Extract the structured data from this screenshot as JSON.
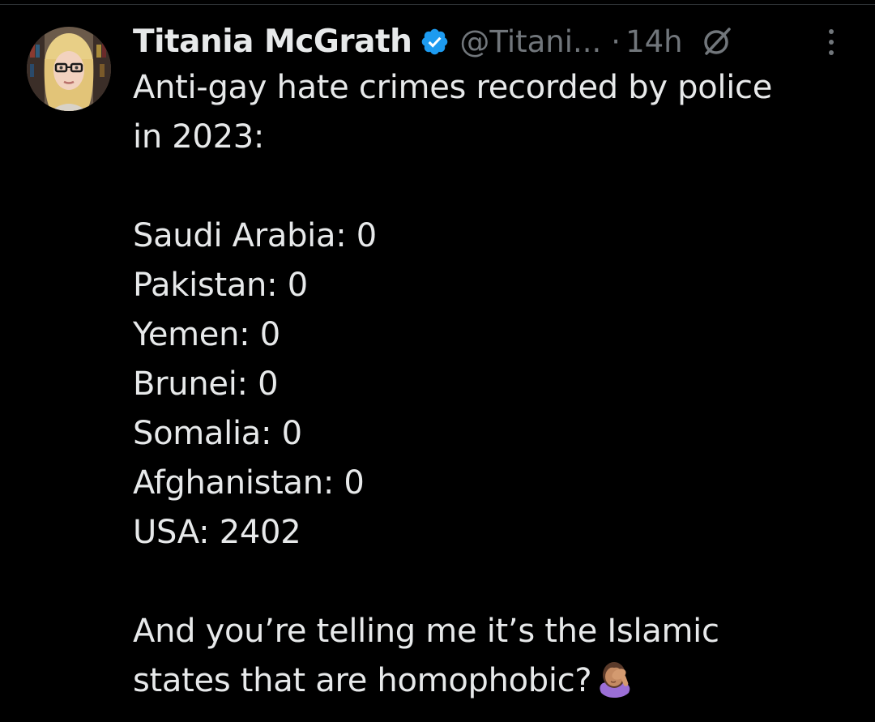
{
  "tweet": {
    "author": {
      "display_name": "Titania McGrath",
      "handle": "@Titani...",
      "verified": true,
      "avatar_icon": "avatar"
    },
    "separator": "·",
    "timestamp": "14h",
    "header_icons": [
      "verified-badge-icon",
      "grok-icon",
      "more-options-icon"
    ],
    "text": {
      "intro_line_1": "Anti-gay hate crimes recorded by police",
      "intro_line_2": "in 2023:",
      "stats": [
        "Saudi Arabia: 0",
        "Pakistan: 0",
        "Yemen: 0",
        "Brunei: 0",
        "Somalia: 0",
        "Afghanistan: 0",
        "USA: 2402"
      ],
      "outro_line_1": "And you’re telling me it’s the Islamic",
      "outro_line_2": "states that are homophobic?",
      "emoji": "face-palm-emoji"
    }
  },
  "colors": {
    "background": "#000000",
    "text_primary": "#e7e9ea",
    "text_secondary": "#71767b",
    "verified_blue": "#1d9bf0",
    "divider": "#2f3336"
  }
}
